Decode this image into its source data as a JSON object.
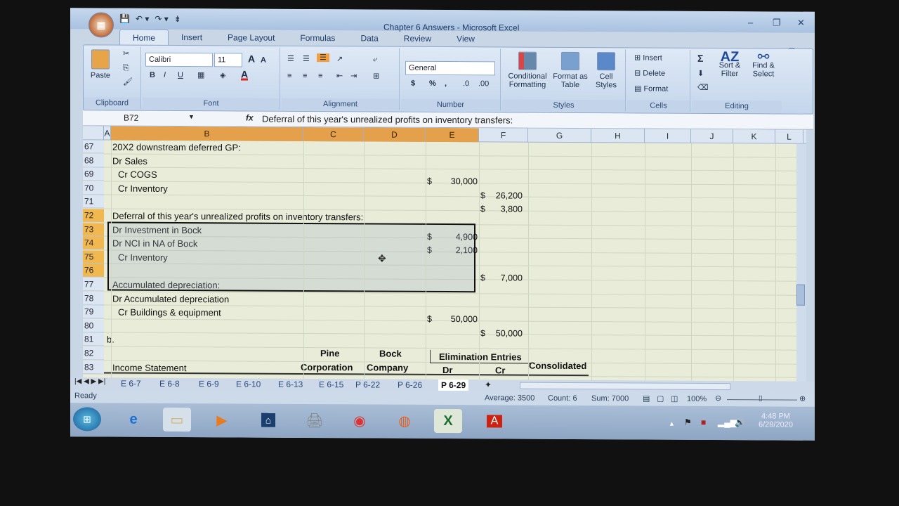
{
  "window": {
    "title": "Chapter 6 Answers - Microsoft Excel",
    "minimize": "–",
    "restore": "❐",
    "close": "✕"
  },
  "qat": {
    "save": "💾",
    "undo": "↶ ▾",
    "redo": "↷ ▾",
    "customize": "⇟"
  },
  "tabs": [
    "Home",
    "Insert",
    "Page Layout",
    "Formulas",
    "Data",
    "Review",
    "View"
  ],
  "ribbon": {
    "clipboard": {
      "label": "Clipboard",
      "paste": "Paste"
    },
    "font": {
      "label": "Font",
      "name": "Calibri",
      "size": "11",
      "bold": "B",
      "italic": "I",
      "underline": "U",
      "grow": "A",
      "shrink": "A",
      "color": "A"
    },
    "alignment": {
      "label": "Alignment"
    },
    "number": {
      "label": "Number",
      "format": "General",
      "currency": "$",
      "percent": "%",
      "comma": ","
    },
    "styles": {
      "label": "Styles",
      "conditional": "Conditional Formatting",
      "table": "Format as Table",
      "cell": "Cell Styles"
    },
    "cells": {
      "label": "Cells",
      "insert": "Insert",
      "delete": "Delete",
      "format": "Format"
    },
    "editing": {
      "label": "Editing",
      "sum": "Σ",
      "sort": "Sort & Filter",
      "find": "Find & Select"
    }
  },
  "formula_bar": {
    "name_box": "B72",
    "fx": "fx",
    "content": "Deferral of this year's unrealized profits on inventory transfers:"
  },
  "columns": [
    "A",
    "B",
    "C",
    "D",
    "E",
    "F",
    "G",
    "H",
    "I",
    "J",
    "K",
    "L"
  ],
  "rows": [
    {
      "n": "67",
      "b": "20X2 downstream deferred GP:"
    },
    {
      "n": "68",
      "b": "Dr Sales"
    },
    {
      "n": "69",
      "b": "  Cr COGS",
      "e": "30,000"
    },
    {
      "n": "70",
      "b": "  Cr Inventory",
      "f": "26,200"
    },
    {
      "n": "71",
      "f": "3,800"
    },
    {
      "n": "72",
      "b": "Deferral of this year's unrealized profits on inventory transfers:"
    },
    {
      "n": "73",
      "b": "Dr Investment in Bock",
      "e": "4,900"
    },
    {
      "n": "74",
      "b": "Dr NCI in NA of Bock",
      "e": "2,100"
    },
    {
      "n": "75",
      "b": "  Cr Inventory"
    },
    {
      "n": "76",
      "f": "7,000"
    },
    {
      "n": "77",
      "b": "Accumulated depreciation:"
    },
    {
      "n": "78",
      "b": "Dr Accumulated depreciation"
    },
    {
      "n": "79",
      "b": "  Cr Buildings & equipment",
      "e": "50,000"
    },
    {
      "n": "80",
      "f": "50,000"
    },
    {
      "n": "81",
      "a": "b."
    },
    {
      "n": "82"
    },
    {
      "n": "83",
      "b": "Income Statement"
    }
  ],
  "currency_symbol": "$",
  "table_header": {
    "c1a": "Pine",
    "c1b": "Corporation",
    "c2a": "Bock",
    "c2b": "Company",
    "elim": "Elimination Entries",
    "dr": "Dr",
    "cr": "Cr",
    "consolidated": "Consolidated"
  },
  "sheet_tabs": [
    "E 6-7",
    "E 6-8",
    "E 6-9",
    "E 6-10",
    "E 6-13",
    "E 6-15",
    "P 6-22",
    "P 6-26",
    "P 6-29"
  ],
  "active_sheet": "P 6-29",
  "status": {
    "ready": "Ready",
    "average": "Average: 3500",
    "count": "Count: 6",
    "sum": "Sum: 7000",
    "zoom": "100%"
  },
  "taskbar": {
    "time": "4:48 PM",
    "date": "6/28/2020"
  },
  "colors": {
    "selected_header": "#e4a04a",
    "accent": "#2a4a78"
  }
}
